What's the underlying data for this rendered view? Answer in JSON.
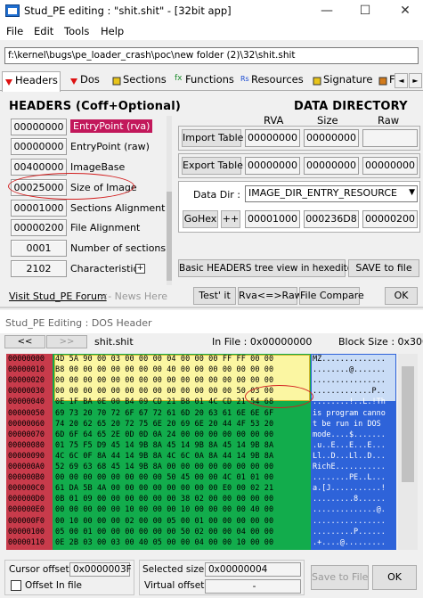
{
  "window": {
    "title": "Stud_PE editing : \"shit.shit\" - [32bit app]",
    "ctl_min": "—",
    "ctl_max": "☐",
    "ctl_close": "✕"
  },
  "menu": [
    "File",
    "Edit",
    "Tools",
    "Help"
  ],
  "path": "f:\\kernel\\bugs\\pe_loader_crash\\poc\\new folder (2)\\32\\shit.shit",
  "tabs": [
    "Headers",
    "Dos",
    "Sections",
    "Functions",
    "Resources",
    "Signature",
    "F"
  ],
  "tab_arrows": [
    "◄",
    "►"
  ],
  "headers": {
    "title": "HEADERS (Coff+Optional)",
    "fields": [
      {
        "value": "00000000",
        "label": "EntryPoint (rva)"
      },
      {
        "value": "00000000",
        "label": "EntryPoint (raw)"
      },
      {
        "value": "00400000",
        "label": "ImageBase"
      },
      {
        "value": "00025000",
        "label": "Size of Image"
      },
      {
        "value": "00001000",
        "label": "Sections Alignment"
      },
      {
        "value": "00000200",
        "label": "File Alignment"
      },
      {
        "value": "0001",
        "label": "Number of sections"
      },
      {
        "value": "2102",
        "label": "Characteristics"
      }
    ],
    "characteristics_btn": "+"
  },
  "datadir": {
    "title": "DATA  DIRECTORY",
    "col_rva": "RVA",
    "col_size": "Size",
    "col_raw": "Raw",
    "import_btn": "Import Table",
    "import_rva": "00000000",
    "import_size": "00000000",
    "import_raw": "",
    "export_btn": "Export Table",
    "export_rva": "00000000",
    "export_size": "00000000",
    "export_raw": "00000000",
    "dd_label": "Data Dir :",
    "dd_select": "IMAGE_DIR_ENTRY_RESOURCE",
    "gohex_btn": "GoHex",
    "plus_btn": "++",
    "dd_rva": "00001000",
    "dd_size": "000236D8",
    "dd_raw": "00000200"
  },
  "buttons": {
    "basic_headers": "Basic HEADERS tree view in hexeditor",
    "save_to_file": "SAVE to file",
    "test_it": "Test' it",
    "rva_raw": "Rva<=>Raw",
    "file_compare": "File Compare",
    "ok": "OK"
  },
  "links": {
    "visit": "Visit Stud_PE Forum",
    "news": "<- News Here"
  },
  "dos": {
    "title": "Stud_PE Editing : DOS Header",
    "nav_prev": "<<",
    "nav_next": ">>",
    "filename": "shit.shit",
    "in_file": "In File : 0x00000000",
    "block_size": "Block Size : 0x300",
    "rows": [
      {
        "off": "00000000",
        "hex": "4D 5A 90 00 03 00 00 00 04 00 00 00 FF FF 00 00",
        "asc": "MZ.............."
      },
      {
        "off": "00000010",
        "hex": "B8 00 00 00 00 00 00 00 40 00 00 00 00 00 00 00",
        "asc": "........@......."
      },
      {
        "off": "00000020",
        "hex": "00 00 00 00 00 00 00 00 00 00 00 00 00 00 00 00",
        "asc": "................"
      },
      {
        "off": "00000030",
        "hex": "00 00 00 00 00 00 00 00 00 00 00 00 00 50 03 00",
        "asc": ".............P.."
      },
      {
        "off": "00000040",
        "hex": "0E 1F BA 0E 00 B4 09 CD 21 B8 01 4C CD 21 54 68",
        "asc": "........!..L.!Th"
      },
      {
        "off": "00000050",
        "hex": "69 73 20 70 72 6F 67 72 61 6D 20 63 61 6E 6E 6F",
        "asc": "is program canno"
      },
      {
        "off": "00000060",
        "hex": "74 20 62 65 20 72 75 6E 20 69 6E 20 44 4F 53 20",
        "asc": "t be run in DOS "
      },
      {
        "off": "00000070",
        "hex": "6D 6F 64 65 2E 0D 0D 0A 24 00 00 00 00 00 00 00",
        "asc": "mode....$......."
      },
      {
        "off": "00000080",
        "hex": "01 75 F5 D9 45 14 9B 8A 45 14 9B 8A 45 14 9B 8A",
        "asc": ".u..E...E...E..."
      },
      {
        "off": "00000090",
        "hex": "4C 6C 0F 8A 44 14 9B 8A 4C 6C 0A 8A 44 14 9B 8A",
        "asc": "Ll..D...Ll..D..."
      },
      {
        "off": "000000A0",
        "hex": "52 69 63 68 45 14 9B 8A 00 00 00 00 00 00 00 00",
        "asc": "RichE..........."
      },
      {
        "off": "000000B0",
        "hex": "00 00 00 00 00 00 00 00 50 45 00 00 4C 01 01 00",
        "asc": "........PE..L..."
      },
      {
        "off": "000000C0",
        "hex": "61 DA 5B 4A 00 00 00 00 00 00 00 00 E0 00 02 21",
        "asc": "a.[J...........!"
      },
      {
        "off": "000000D0",
        "hex": "0B 01 09 00 00 00 00 00 00 38 02 00 00 00 00 00",
        "asc": ".........8......"
      },
      {
        "off": "000000E0",
        "hex": "00 00 00 00 00 10 00 00 00 10 00 00 00 00 40 00",
        "asc": "..............@."
      },
      {
        "off": "000000F0",
        "hex": "00 10 00 00 00 02 00 00 05 00 01 00 00 00 00 00",
        "asc": "................"
      },
      {
        "off": "00000100",
        "hex": "05 00 01 00 00 00 00 00 00 50 02 00 00 04 00 00",
        "asc": ".........P......"
      },
      {
        "off": "00000110",
        "hex": "0E 2B 03 00 03 00 40 05 00 00 04 00 00 10 00 00",
        "asc": ".+....@........."
      }
    ],
    "cursor_offset_label": "Cursor offset :",
    "cursor_offset_value": "0x0000003F",
    "offset_in_file_label": "Offset In file",
    "selected_size_label": "Selected size :",
    "selected_size_value": "0x00000004",
    "virtual_offset_label": "Virtual offset :",
    "virtual_offset_value": "-",
    "save_to_file": "Save to File",
    "ok": "OK"
  }
}
